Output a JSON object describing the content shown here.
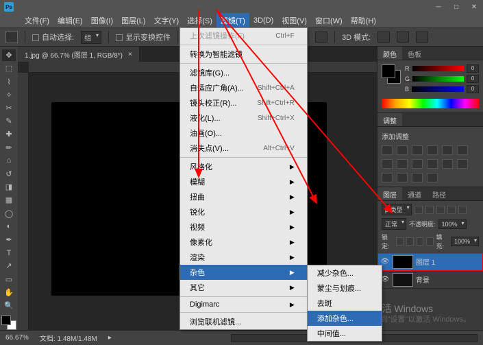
{
  "app": {
    "logo": "Ps"
  },
  "window_buttons": {
    "min": "─",
    "max": "□",
    "close": "✕"
  },
  "menu": {
    "items": [
      "文件(F)",
      "编辑(E)",
      "图像(I)",
      "图层(L)",
      "文字(Y)",
      "选择(S)",
      "滤镜(T)",
      "3D(D)",
      "视图(V)",
      "窗口(W)",
      "帮助(H)"
    ],
    "open_index": 6
  },
  "options_bar": {
    "auto_select": "自动选择:",
    "auto_select_value": "组",
    "show_transform": "显示变换控件",
    "mode3d_label": "3D 模式:"
  },
  "document": {
    "tab": "1.jpg @ 66.7% (图层 1, RGB/8*)",
    "close": "×"
  },
  "filter_menu": {
    "last": "上次滤镜操作(F)",
    "last_sc": "Ctrl+F",
    "smart": "转换为智能滤镜",
    "gallery": "滤镜库(G)...",
    "adaptive": "自适应广角(A)...",
    "adaptive_sc": "Shift+Ctrl+A",
    "lens": "镜头校正(R)...",
    "lens_sc": "Shift+Ctrl+R",
    "liquify": "液化(L)...",
    "liquify_sc": "Shift+Ctrl+X",
    "oil": "油画(O)...",
    "vanish": "消失点(V)...",
    "vanish_sc": "Alt+Ctrl+V",
    "stylize": "风格化",
    "blur": "模糊",
    "distort": "扭曲",
    "sharpen": "锐化",
    "video": "视频",
    "pixelate": "像素化",
    "render": "渲染",
    "noise": "杂色",
    "other": "其它",
    "digimarc": "Digimarc",
    "browse": "浏览联机滤镜..."
  },
  "noise_submenu": {
    "reduce": "减少杂色...",
    "dust": "蒙尘与划痕...",
    "despeckle": "去斑",
    "add": "添加杂色...",
    "median": "中间值..."
  },
  "panels": {
    "color_tab": "颜色",
    "swatch_tab": "色板",
    "r": "R",
    "g": "G",
    "b": "B",
    "r_val": "0",
    "g_val": "0",
    "b_val": "0",
    "adjust_tab": "调整",
    "adjust_label": "添加调整",
    "layers_tab": "图层",
    "channels_tab": "通道",
    "paths_tab": "路径",
    "kind": "ρ 类型",
    "blend": "正常",
    "opacity_label": "不透明度:",
    "opacity_val": "100%",
    "lock_label": "锁定:",
    "fill_label": "填充:",
    "fill_val": "100%",
    "layer1": "图层 1",
    "background": "背景"
  },
  "status": {
    "zoom": "66.67%",
    "doc": "文档: 1.48M/1.48M"
  },
  "watermark": {
    "line1": "激活 Windows",
    "line2": "转到\"设置\"以激活 Windows。"
  }
}
